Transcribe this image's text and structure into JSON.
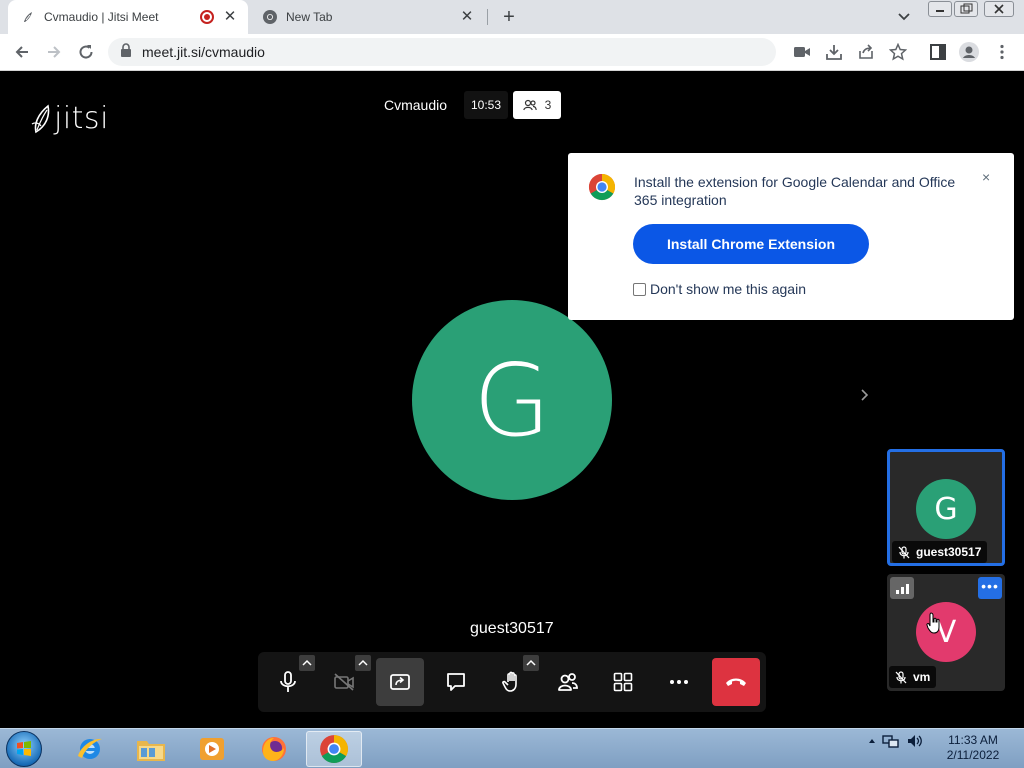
{
  "browser": {
    "tabs": [
      {
        "title": "Cvmaudio | Jitsi Meet",
        "active": true,
        "recording": true
      },
      {
        "title": "New Tab",
        "active": false
      }
    ],
    "url": "meet.jit.si/cvmaudio"
  },
  "meeting": {
    "logo_text": "jitsi",
    "conference_name": "Cvmaudio",
    "elapsed_time": "10:53",
    "participant_count": "3",
    "dominant_speaker_initial": "G",
    "dominant_speaker_name": "guest30517"
  },
  "filmstrip": {
    "tiles": [
      {
        "initial": "G",
        "name": "guest30517",
        "color": "#2aa076",
        "selected": true
      },
      {
        "initial": "V",
        "name": "vm",
        "color": "#e23a6d",
        "selected": false
      }
    ]
  },
  "calendar_popup": {
    "message": "Install the extension for Google Calendar and Office 365 integration",
    "install_label": "Install Chrome Extension",
    "dont_show_label": "Don't show me this again",
    "close_glyph": "×"
  },
  "toolbox": {
    "buttons": [
      "microphone",
      "camera",
      "screenshare",
      "chat",
      "raise-hand",
      "participants",
      "tile-view",
      "more",
      "hangup"
    ],
    "hangup_color": "#dd3340"
  },
  "taskbar": {
    "time": "11:33 AM",
    "date": "2/11/2022"
  },
  "colors": {
    "accent": "#246fe5",
    "install_button": "#0b57e6"
  }
}
